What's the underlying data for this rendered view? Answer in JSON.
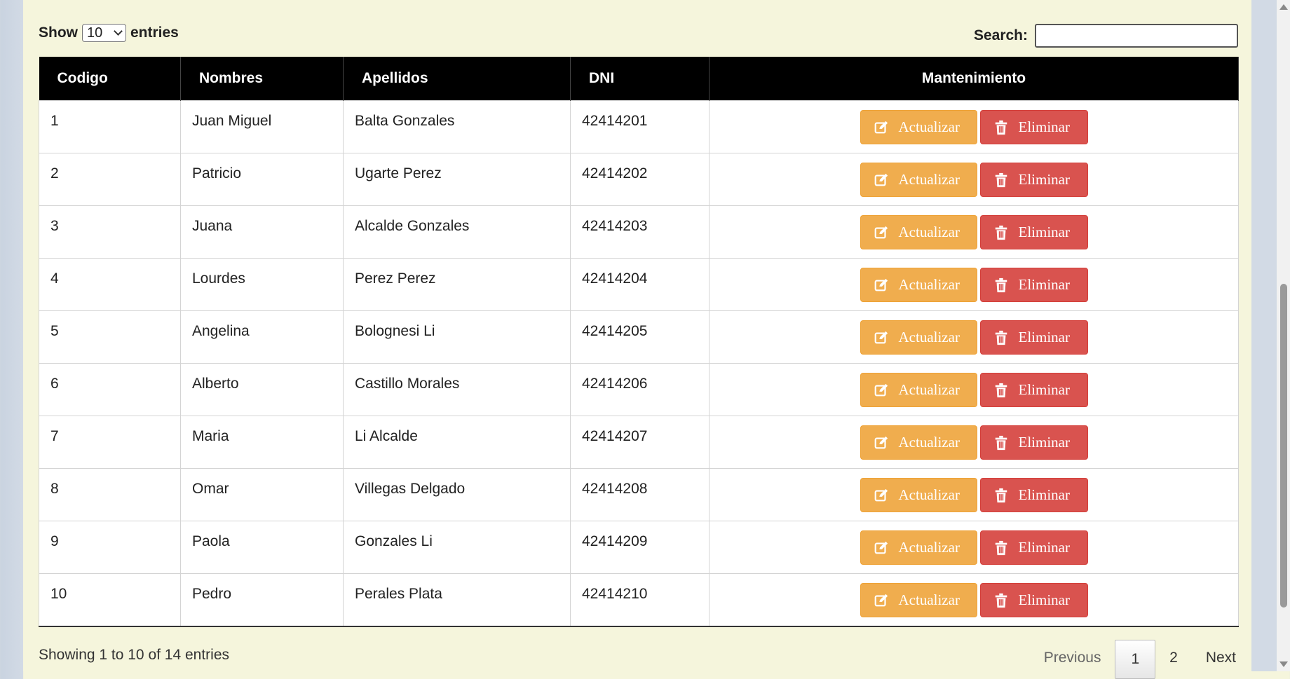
{
  "controls": {
    "show_label": "Show",
    "length_value": "10",
    "entries_label": "entries",
    "search_label": "Search:",
    "search_value": ""
  },
  "table": {
    "headers": [
      "Codigo",
      "Nombres",
      "Apellidos",
      "DNI",
      "Mantenimiento"
    ],
    "rows": [
      {
        "codigo": "1",
        "nombres": "Juan Miguel",
        "apellidos": "Balta Gonzales",
        "dni": "42414201"
      },
      {
        "codigo": "2",
        "nombres": "Patricio",
        "apellidos": "Ugarte Perez",
        "dni": "42414202"
      },
      {
        "codigo": "3",
        "nombres": "Juana",
        "apellidos": "Alcalde Gonzales",
        "dni": "42414203"
      },
      {
        "codigo": "4",
        "nombres": "Lourdes",
        "apellidos": "Perez Perez",
        "dni": "42414204"
      },
      {
        "codigo": "5",
        "nombres": "Angelina",
        "apellidos": "Bolognesi Li",
        "dni": "42414205"
      },
      {
        "codigo": "6",
        "nombres": "Alberto",
        "apellidos": "Castillo Morales",
        "dni": "42414206"
      },
      {
        "codigo": "7",
        "nombres": "Maria",
        "apellidos": "Li Alcalde",
        "dni": "42414207"
      },
      {
        "codigo": "8",
        "nombres": "Omar",
        "apellidos": "Villegas Delgado",
        "dni": "42414208"
      },
      {
        "codigo": "9",
        "nombres": "Paola",
        "apellidos": "Gonzales Li",
        "dni": "42414209"
      },
      {
        "codigo": "10",
        "nombres": "Pedro",
        "apellidos": "Perales Plata",
        "dni": "42414210"
      }
    ],
    "update_label": "Actualizar",
    "delete_label": "Eliminar",
    "update_icon": "edit-icon",
    "delete_icon": "trash-icon"
  },
  "footer": {
    "info": "Showing 1 to 10 of 14 entries",
    "previous": "Previous",
    "pages": [
      "1",
      "2"
    ],
    "current_page": "1",
    "next": "Next"
  },
  "colors": {
    "page_bg": "#f5f5dc",
    "header_bg": "#000000",
    "update_btn": "#f0ad4e",
    "delete_btn": "#d9534f"
  }
}
